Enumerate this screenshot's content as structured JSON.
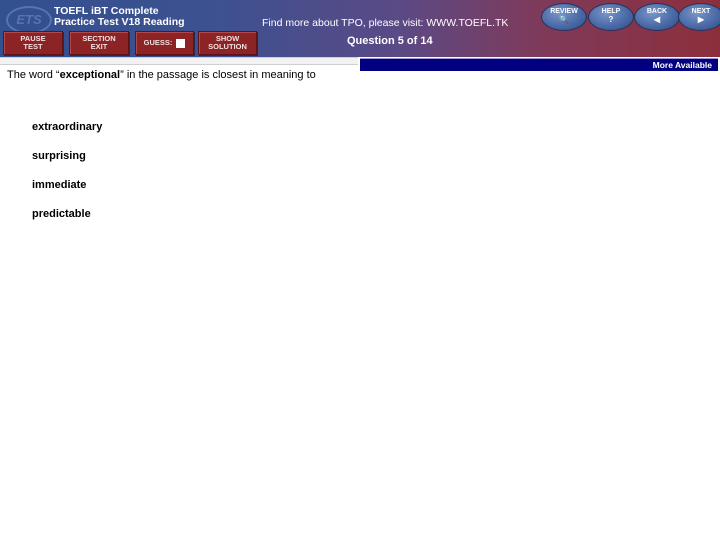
{
  "header": {
    "logo_text": "ETS",
    "app_title_line1": "TOEFL iBT Complete",
    "app_title_line2": "Practice Test V18 Reading",
    "promo_text": "Find more about TPO,  please visit:  WWW.TOEFL.TK",
    "question_counter": "Question 5 of 14"
  },
  "toolbar": {
    "pause_line1": "PAUSE",
    "pause_line2": "TEST",
    "section_line1": "SECTION",
    "section_line2": "EXIT",
    "guess_label": "GUESS:",
    "show_line1": "SHOW",
    "show_line2": "SOLUTION"
  },
  "nav": {
    "review_label": "REVIEW",
    "help_label": "HELP",
    "help_icon": "?",
    "back_label": "BACK",
    "back_icon": "◀",
    "next_label": "NEXT",
    "next_icon": "▶",
    "review_icon": "🔍"
  },
  "passage_bar": {
    "more_available": "More Available"
  },
  "question": {
    "prefix": "The word “",
    "keyword": "exceptional",
    "suffix": "” in the passage is closest in meaning to",
    "options": [
      "extraordinary",
      "surprising",
      "immediate",
      "predictable"
    ]
  }
}
